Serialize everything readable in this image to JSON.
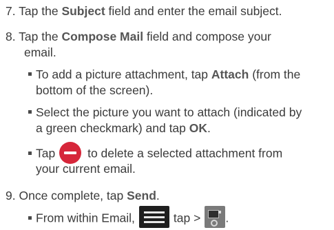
{
  "steps": {
    "s7": {
      "num": "7.",
      "pre": "Tap the ",
      "bold": "Subject",
      "post": " field and enter the email subject."
    },
    "s8": {
      "num": "8.",
      "pre": "Tap the ",
      "bold": "Compose Mail",
      "post1": " field and compose your",
      "post2": "email.",
      "bullets": {
        "b1": {
          "pre": "To add a picture attachment, tap ",
          "bold": "Attach",
          "post1": " (from the",
          "line2": "bottom of the screen)."
        },
        "b2": {
          "line1": "Select the picture you want to attach (indicated by",
          "pre2": "a green checkmark) and tap ",
          "bold": "OK",
          "post2": "."
        },
        "b3": {
          "pre": "Tap",
          "post1": "to delete a selected attachment from",
          "line2": "your current email."
        }
      }
    },
    "s9": {
      "num": "9.",
      "pre": "Once complete, tap ",
      "bold": "Send",
      "post": ".",
      "bullet": {
        "pre": "From within Email,",
        "mid": "tap >",
        "post": "."
      }
    }
  },
  "icons": {
    "remove_attachment": "minus-circle-icon",
    "menu": "menu-icon",
    "account_settings": "account-settings-icon"
  },
  "colors": {
    "remove_icon": "#d6263a",
    "menu_icon_bg": "#1f1f1f"
  }
}
